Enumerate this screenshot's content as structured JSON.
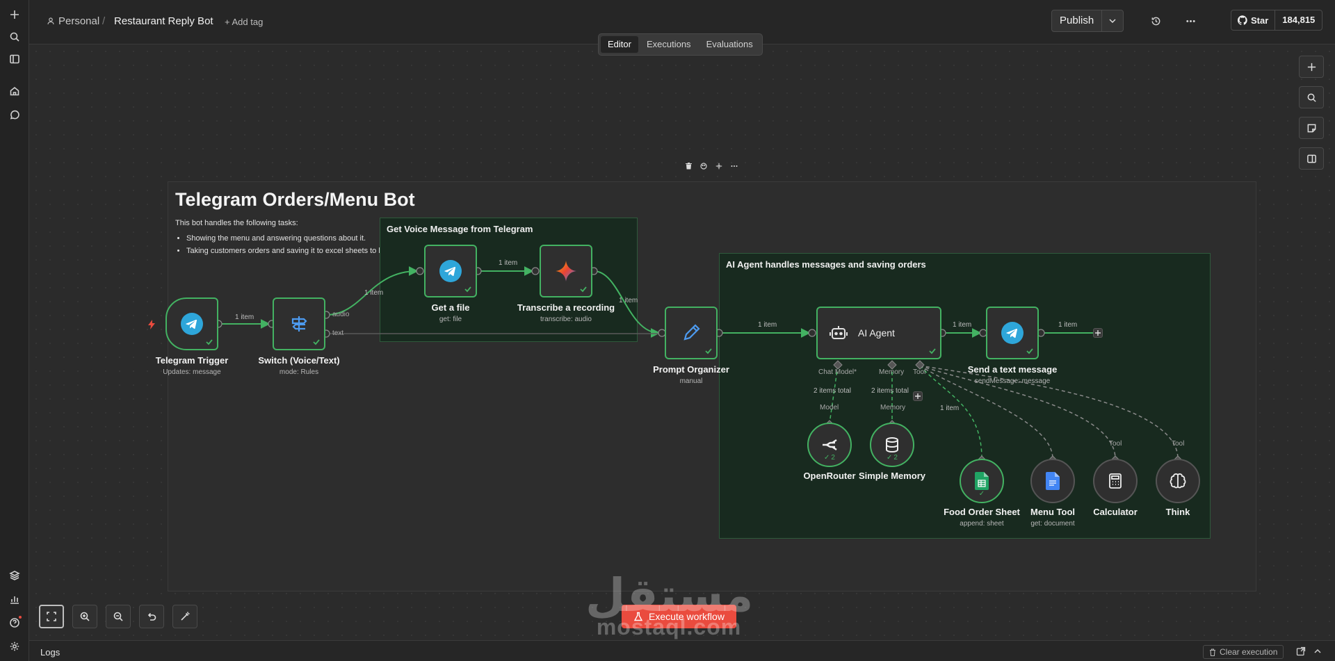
{
  "header": {
    "workspace": "Personal",
    "separator": "/",
    "workflow_title": "Restaurant Reply Bot",
    "add_tag": "+ Add tag",
    "publish": "Publish",
    "github_star": "Star",
    "github_count": "184,815"
  },
  "tabs": [
    {
      "label": "Editor",
      "active": true
    },
    {
      "label": "Executions",
      "active": false
    },
    {
      "label": "Evaluations",
      "active": false
    }
  ],
  "sticky": {
    "title": "Telegram Orders/Menu Bot",
    "intro": "This bot handles the following tasks:",
    "bullets": [
      "Showing the menu and answering questions about it.",
      "Taking customers orders and saving it to excel sheets to be reviewed."
    ]
  },
  "groups": {
    "voice": "Get Voice Message from Telegram",
    "agent": "AI Agent handles messages and saving orders"
  },
  "nodes": {
    "telegram_trigger": {
      "title": "Telegram Trigger",
      "sub": "Updates: message"
    },
    "switch": {
      "title": "Switch (Voice/Text)",
      "sub": "mode: Rules",
      "out_audio": "audio",
      "out_text": "text"
    },
    "get_file": {
      "title": "Get a file",
      "sub": "get: file"
    },
    "transcribe": {
      "title": "Transcribe a recording",
      "sub": "transcribe: audio"
    },
    "prompt": {
      "title": "Prompt Organizer",
      "sub": "manual"
    },
    "agent": {
      "title": "AI Agent",
      "port_chat": "Chat Model*",
      "port_memory": "Memory",
      "port_tool": "Tool"
    },
    "send": {
      "title": "Send a text message",
      "sub": "sendMessage: message"
    },
    "openrouter": {
      "title": "OpenRouter",
      "label": "Model",
      "count": "2"
    },
    "memory": {
      "title": "Simple Memory",
      "label": "Memory",
      "count": "2"
    },
    "sheet": {
      "title": "Food Order Sheet",
      "sub": "append: sheet"
    },
    "menu_tool": {
      "title": "Menu Tool",
      "sub": "get: document"
    },
    "calculator": {
      "title": "Calculator",
      "label": "Tool"
    },
    "think": {
      "title": "Think",
      "label": "Tool"
    }
  },
  "edges": {
    "e1": "1 item",
    "e2": "1 item",
    "e3": "1 item",
    "e4": "1 item",
    "e5": "1 item",
    "e6": "1 item",
    "e7": "1 item",
    "model_total": "2 items total",
    "memory_total": "2 items total",
    "tool_item": "1 item"
  },
  "actions": {
    "execute": "Execute workflow"
  },
  "watermark": {
    "arabic": "مستقل",
    "latin": "mostaql.com"
  },
  "logs": {
    "title": "Logs",
    "clear": "Clear execution"
  },
  "colors": {
    "accent_green": "#43b262",
    "execute": "#ea4b3e",
    "telegram": "#2ea6da"
  }
}
